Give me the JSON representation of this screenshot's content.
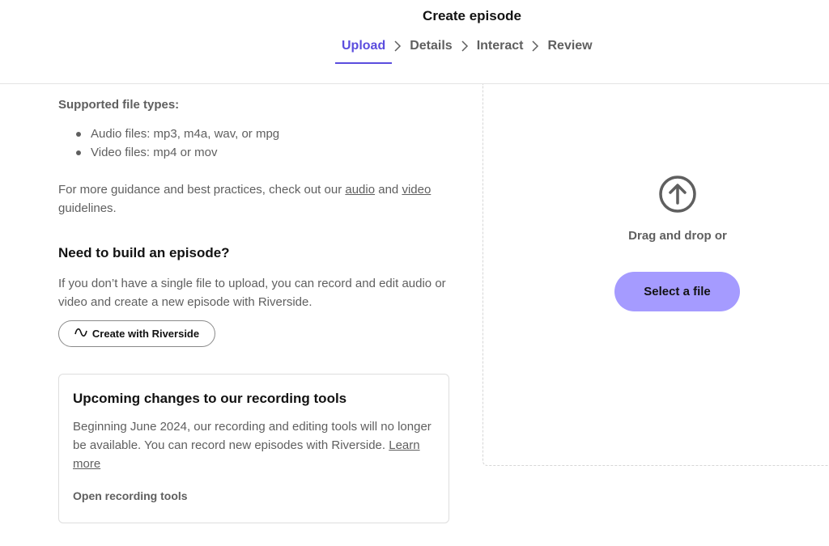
{
  "header": {
    "title": "Create episode",
    "steps": [
      {
        "label": "Upload"
      },
      {
        "label": "Details"
      },
      {
        "label": "Interact"
      },
      {
        "label": "Review"
      }
    ]
  },
  "info": {
    "supported_title": "Supported file types:",
    "file_types": [
      "Audio files: mp3, m4a, wav, or mpg",
      "Video files: mp4 or mov"
    ],
    "guidance_prefix": "For more guidance and best practices, check out our",
    "audio_link": "audio",
    "and_text": "and",
    "video_link": "video",
    "guidance_suffix": "guidelines."
  },
  "build": {
    "title": "Need to build an episode?",
    "description": "If you don’t have a single file to upload, you can record and edit audio or video and create a new episode with Riverside.",
    "button_label": "Create with Riverside"
  },
  "notice": {
    "title": "Upcoming changes to our recording tools",
    "text": "Beginning June 2024, our recording and editing tools will no longer be available. You can record new episodes with Riverside.",
    "learn_more": "Learn more",
    "link": "Open recording tools"
  },
  "dropzone": {
    "icon": "upload-arrow-icon",
    "drag_text": "Drag and drop or",
    "select_button": "Select a file"
  },
  "colors": {
    "accent": "#5b4dde",
    "select_button_bg": "#a59bff",
    "muted_text": "#5f5f5f"
  }
}
